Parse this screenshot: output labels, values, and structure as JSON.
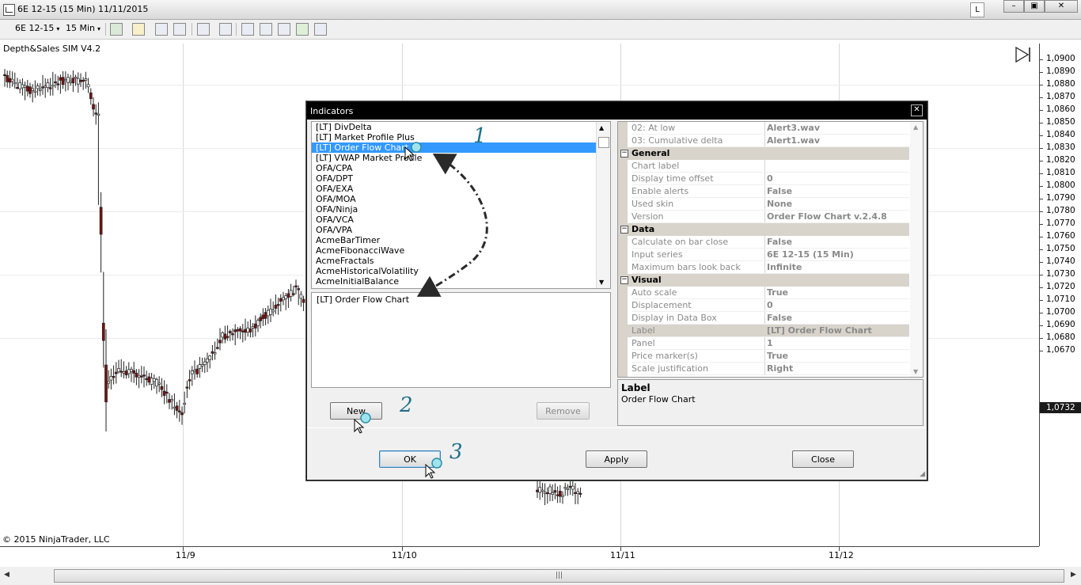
{
  "window": {
    "title": "6E 12-15 (15 Min)  11/11/2015",
    "badge": "L",
    "minimize": "–",
    "maximize": "▣",
    "close": "✕"
  },
  "toolbar": {
    "instrument": "6E 12-15",
    "interval": "15 Min",
    "dropdown_arrow": "▾"
  },
  "chart": {
    "indicator_label": "Depth&Sales SIM V4.2",
    "copyright": "© 2015 NinjaTrader, LLC",
    "current_price": "1,0732",
    "price_labels": [
      "1,0900",
      "1,0890",
      "1,0880",
      "1,0870",
      "1,0860",
      "1,0850",
      "1,0840",
      "1,0830",
      "1,0820",
      "1,0810",
      "1,0800",
      "1,0790",
      "1,0780",
      "1,0770",
      "1,0760",
      "1,0750",
      "1,0740",
      "1,0730",
      "1,0720",
      "1,0710",
      "1,0700",
      "1,0690",
      "1,0680",
      "1,0670"
    ],
    "date_labels": [
      "11/9",
      "11/10",
      "11/11",
      "11/12"
    ]
  },
  "scrollbar": {
    "left_arrow": "◀",
    "right_arrow": "▶",
    "grip": "|||"
  },
  "dialog": {
    "title": "Indicators",
    "close_glyph": "✕",
    "indicator_list": [
      "[LT] DivDelta",
      "[LT] Market Profile Plus",
      "[LT] Order Flow Chart",
      "[LT] VWAP Market Profile",
      "OFA/CPA",
      "OFA/DPT",
      "OFA/EXA",
      "OFA/MOA",
      "OFA/Ninja",
      "OFA/VCA",
      "OFA/VPA",
      "AcmeBarTimer",
      "AcmeFibonacciWave",
      "AcmeFractals",
      "AcmeHistoricalVolatility",
      "AcmeInitialBalance"
    ],
    "selected_index": 2,
    "added_list": [
      "[LT] Order Flow Chart"
    ],
    "buttons": {
      "new": "New",
      "remove": "Remove",
      "ok": "OK",
      "apply": "Apply",
      "close": "Close"
    },
    "properties": {
      "top_rows": [
        {
          "key": "02: At low",
          "value": "Alert3.wav"
        },
        {
          "key": "03: Cumulative delta",
          "value": "Alert1.wav"
        }
      ],
      "categories": [
        {
          "name": "General",
          "rows": [
            {
              "key": "Chart label",
              "value": ""
            },
            {
              "key": "Display time offset",
              "value": "0"
            },
            {
              "key": "Enable alerts",
              "value": "False"
            },
            {
              "key": "Used skin",
              "value": "None"
            },
            {
              "key": "Version",
              "value": "Order Flow Chart v.2.4.8"
            }
          ]
        },
        {
          "name": "Data",
          "rows": [
            {
              "key": "Calculate on bar close",
              "value": "False"
            },
            {
              "key": "Input series",
              "value": "6E 12-15 (15 Min)"
            },
            {
              "key": "Maximum bars look back",
              "value": "Infinite"
            }
          ]
        },
        {
          "name": "Visual",
          "rows": [
            {
              "key": "Auto scale",
              "value": "True"
            },
            {
              "key": "Displacement",
              "value": "0"
            },
            {
              "key": "Display in Data Box",
              "value": "False"
            },
            {
              "key": "Label",
              "value": "[LT] Order Flow Chart"
            },
            {
              "key": "Panel",
              "value": "1"
            },
            {
              "key": "Price marker(s)",
              "value": "True"
            },
            {
              "key": "Scale justification",
              "value": "Right"
            }
          ]
        }
      ],
      "collapse_glyph": "⊟"
    },
    "description": {
      "heading": "Label",
      "text": "Order Flow Chart"
    }
  },
  "annotations": {
    "step1": "1",
    "step2": "2",
    "step3": "3"
  },
  "colors": {
    "candle_body": "#7a1010",
    "selection": "#3399ff",
    "category_bg": "#d8d4cb",
    "step_color": "#1f6f8b"
  }
}
